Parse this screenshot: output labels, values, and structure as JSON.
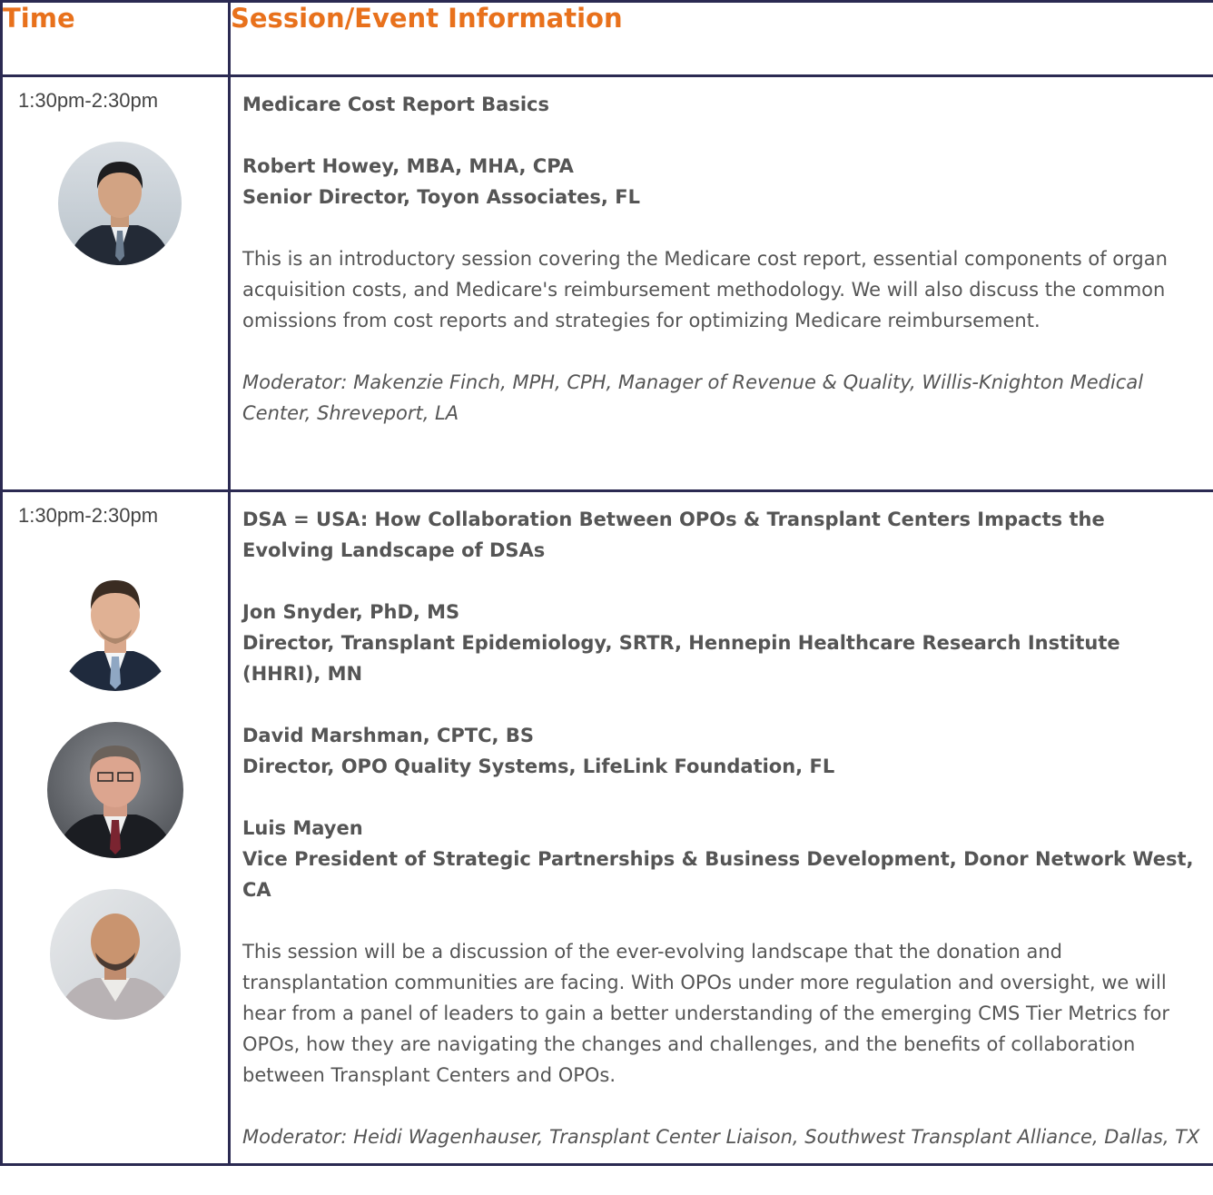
{
  "header": {
    "time_label": "Time",
    "info_label": "Session/Event Information"
  },
  "sessions": [
    {
      "time": "1:30pm-2:30pm",
      "title": "Medicare Cost Report Basics",
      "speakers": [
        {
          "name": "Robert Howey, MBA, MHA, CPA",
          "role": "Senior Director, Toyon Associates, FL"
        }
      ],
      "description": "This is an introductory session covering the Medicare cost report, essential components of organ acquisition costs, and Medicare's reimbursement methodology. We will also discuss the common omissions from cost reports and strategies for optimizing Medicare reimbursement.",
      "moderator": "Moderator: Makenzie Finch, MPH, CPH, Manager of Revenue & Quality, Willis-Knighton Medical Center, Shreveport, LA"
    },
    {
      "time": "1:30pm-2:30pm",
      "title": "DSA = USA: How Collaboration Between OPOs & Transplant Centers Impacts the Evolving Landscape of DSAs",
      "speakers": [
        {
          "name": "Jon Snyder, PhD, MS",
          "role": "Director, Transplant Epidemiology, SRTR, Hennepin Healthcare Research Institute (HHRI), MN"
        },
        {
          "name": "David Marshman, CPTC, BS",
          "role": "Director, OPO Quality Systems, LifeLink Foundation, FL"
        },
        {
          "name": "Luis Mayen",
          "role": "Vice President of Strategic Partnerships & Business Development, Donor Network West, CA"
        }
      ],
      "description": "This session will be a discussion of the ever-evolving landscape that the donation and transplantation communities are facing. With OPOs under more regulation and oversight, we will hear from a panel of leaders to gain a better understanding of the emerging CMS Tier Metrics for OPOs, how they are navigating the changes and challenges, and the benefits of collaboration between Transplant Centers and OPOs.",
      "moderator": "Moderator: Heidi Wagenhauser, Transplant Center Liaison, Southwest Transplant Alliance, Dallas, TX"
    }
  ],
  "colors": {
    "header_text": "#e8711c",
    "border": "#2b2a52",
    "body_text": "#555555"
  }
}
